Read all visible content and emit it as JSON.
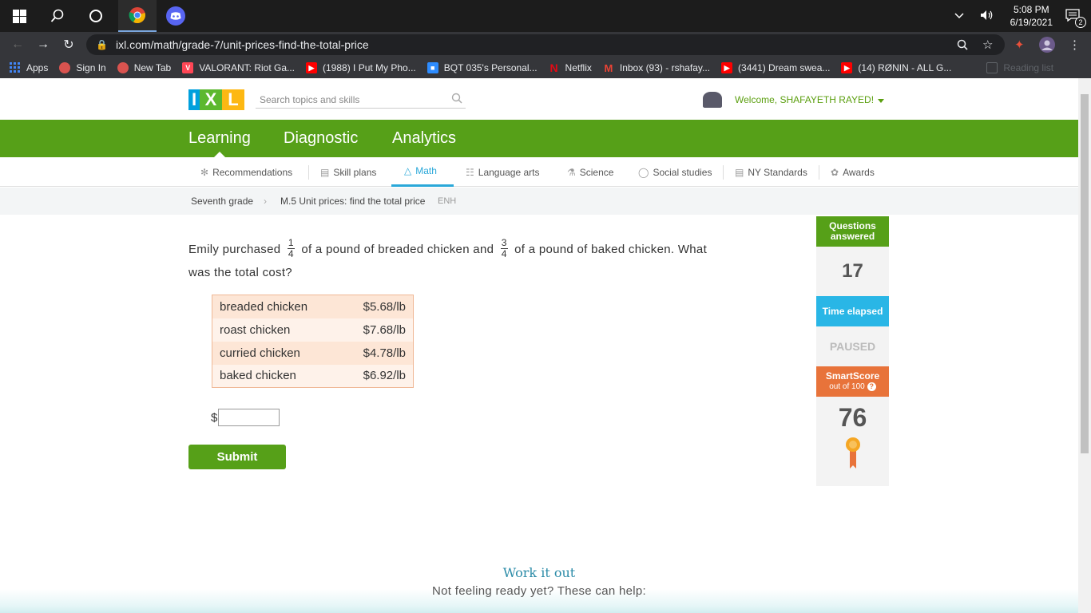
{
  "taskbar": {
    "time": "5:08 PM",
    "date": "6/19/2021",
    "notification_count": "2",
    "icons": [
      "windows-icon",
      "search-icon",
      "cortana-icon",
      "chrome-icon",
      "discord-icon"
    ]
  },
  "browser": {
    "url": "ixl.com/math/grade-7/unit-prices-find-the-total-price",
    "bookmarks": [
      {
        "label": "Apps",
        "icon": "apps-grid",
        "color": "#4285f4"
      },
      {
        "label": "Sign In",
        "icon": "signin",
        "color": "#d9534f"
      },
      {
        "label": "New Tab",
        "icon": "newtab",
        "color": "#d9534f"
      },
      {
        "label": "VALORANT: Riot Ga...",
        "icon": "valorant",
        "color": "#ff4655"
      },
      {
        "label": "(1988) I Put My Pho...",
        "icon": "youtube",
        "color": "#ff0000"
      },
      {
        "label": "BQT 035's Personal...",
        "icon": "zoom",
        "color": "#2d8cff"
      },
      {
        "label": "Netflix",
        "icon": "netflix",
        "color": "#e50914"
      },
      {
        "label": "Inbox (93) - rshafay...",
        "icon": "gmail",
        "color": "#ea4335"
      },
      {
        "label": "(3441) Dream swea...",
        "icon": "youtube",
        "color": "#ff0000"
      },
      {
        "label": "(14) RØNIN - ALL G...",
        "icon": "youtube",
        "color": "#ff0000"
      }
    ],
    "reading_list": "Reading list"
  },
  "ixl": {
    "search_placeholder": "Search topics and skills",
    "welcome": "Welcome, SHAFAYETH RAYED!",
    "main_tabs": [
      "Learning",
      "Diagnostic",
      "Analytics"
    ],
    "active_main_tab": "Learning",
    "subnav": [
      {
        "label": "Recommendations",
        "icon": "recommendations-icon"
      },
      {
        "label": "Skill plans",
        "icon": "skill-plans-icon"
      },
      {
        "label": "Math",
        "icon": "math-icon",
        "active": true
      },
      {
        "label": "Language arts",
        "icon": "book-icon"
      },
      {
        "label": "Science",
        "icon": "science-icon"
      },
      {
        "label": "Social studies",
        "icon": "globe-icon"
      },
      {
        "label": "NY Standards",
        "icon": "standards-icon"
      },
      {
        "label": "Awards",
        "icon": "awards-icon"
      }
    ],
    "breadcrumb": {
      "grade": "Seventh grade",
      "skill": "M.5 Unit prices: find the total price",
      "code": "ENH"
    }
  },
  "question": {
    "text_1": "Emily purchased",
    "frac_1_num": "1",
    "frac_1_den": "4",
    "text_2": "of a pound of breaded chicken and",
    "frac_2_num": "3",
    "frac_2_den": "4",
    "text_3": "of a pound of baked chicken. What was the total cost?"
  },
  "price_table": [
    {
      "item": "breaded chicken",
      "price": "$5.68/lb"
    },
    {
      "item": "roast chicken",
      "price": "$7.68/lb"
    },
    {
      "item": "curried chicken",
      "price": "$4.78/lb"
    },
    {
      "item": "baked chicken",
      "price": "$6.92/lb"
    }
  ],
  "answer": {
    "currency": "$",
    "value": ""
  },
  "submit_label": "Submit",
  "stats": {
    "questions_label": "Questions answered",
    "questions_value": "17",
    "time_label": "Time elapsed",
    "time_value": "PAUSED",
    "score_label": "SmartScore",
    "score_sublabel": "out of 100",
    "score_value": "76"
  },
  "footer": {
    "title": "Work it out",
    "subtitle": "Not feeling ready yet? These can help:"
  },
  "colors": {
    "ixl_green": "#56a018",
    "math_blue": "#2aa8d9",
    "time_blue": "#29b6e6",
    "smartscore_orange": "#e8733a",
    "table_border": "#f0b896"
  }
}
